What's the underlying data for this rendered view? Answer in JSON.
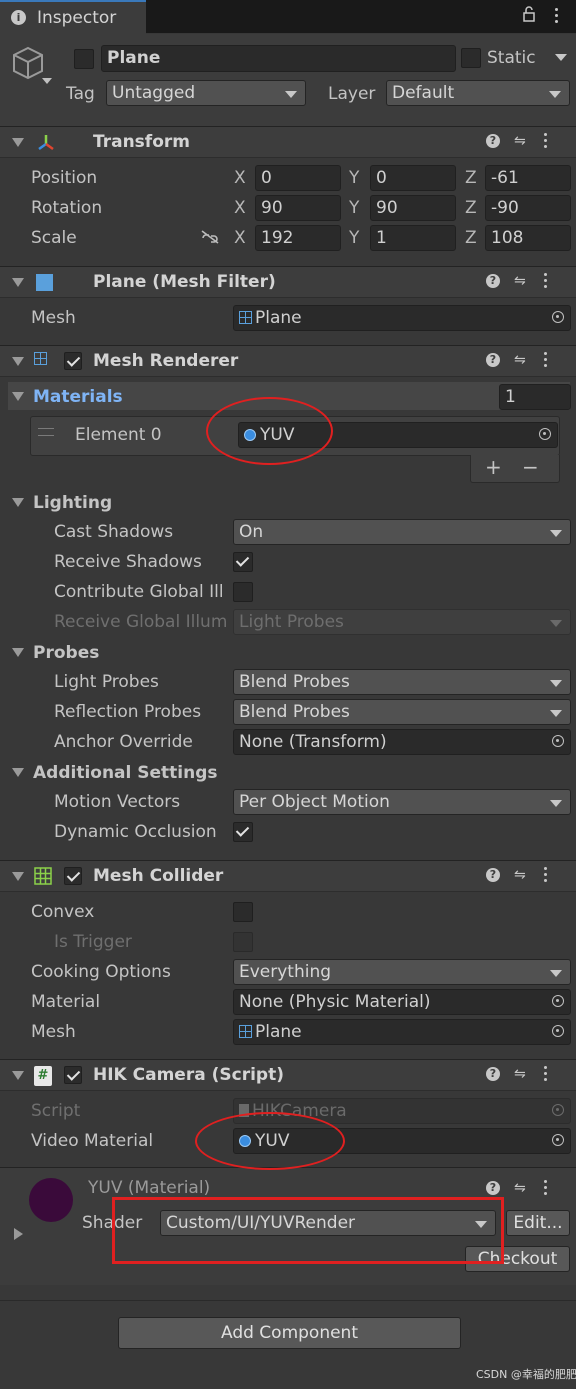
{
  "tab": {
    "title": "Inspector"
  },
  "object": {
    "name": "Plane",
    "static_label": "Static",
    "tag_label": "Tag",
    "tag_value": "Untagged",
    "layer_label": "Layer",
    "layer_value": "Default"
  },
  "transform": {
    "title": "Transform",
    "rows": [
      {
        "label": "Position",
        "x": "0",
        "y": "0",
        "z": "-61"
      },
      {
        "label": "Rotation",
        "x": "90",
        "y": "90",
        "z": "-90"
      },
      {
        "label": "Scale",
        "x": "192",
        "y": "1",
        "z": "108"
      }
    ],
    "axis": {
      "x": "X",
      "y": "Y",
      "z": "Z"
    }
  },
  "mesh_filter": {
    "title": "Plane (Mesh Filter)",
    "mesh_label": "Mesh",
    "mesh_value": "Plane"
  },
  "mesh_renderer": {
    "title": "Mesh Renderer",
    "materials_label": "Materials",
    "materials_count": "1",
    "element_label": "Element 0",
    "element_value": "YUV",
    "plus": "+",
    "minus": "−",
    "lighting_label": "Lighting",
    "cast_shadows_label": "Cast Shadows",
    "cast_shadows_value": "On",
    "receive_shadows_label": "Receive Shadows",
    "contribute_gi_label": "Contribute Global Ill",
    "receive_gi_label": "Receive Global Illum",
    "receive_gi_value": "Light Probes",
    "probes_label": "Probes",
    "light_probes_label": "Light Probes",
    "light_probes_value": "Blend Probes",
    "reflection_probes_label": "Reflection Probes",
    "reflection_probes_value": "Blend Probes",
    "anchor_label": "Anchor Override",
    "anchor_value": "None (Transform)",
    "additional_label": "Additional Settings",
    "motion_label": "Motion Vectors",
    "motion_value": "Per Object Motion",
    "dynamic_occ_label": "Dynamic Occlusion"
  },
  "mesh_collider": {
    "title": "Mesh Collider",
    "convex_label": "Convex",
    "trigger_label": "Is Trigger",
    "cooking_label": "Cooking Options",
    "cooking_value": "Everything",
    "material_label": "Material",
    "material_value": "None (Physic Material)",
    "mesh_label": "Mesh",
    "mesh_value": "Plane"
  },
  "hik_camera": {
    "title": "HIK Camera (Script)",
    "script_label": "Script",
    "script_value": "HIKCamera",
    "video_label": "Video Material",
    "video_value": "YUV"
  },
  "material": {
    "title": "YUV (Material)",
    "shader_label": "Shader",
    "shader_value": "Custom/UI/YUVRender",
    "edit_label": "Edit...",
    "checkout_label": "Checkout",
    "swatch_color": "#3a0a3a"
  },
  "add_component_label": "Add Component",
  "watermark": "CSDN @幸福的肥肥",
  "colors": {
    "accent": "#7fb4f5",
    "annotation": "#e02020"
  }
}
